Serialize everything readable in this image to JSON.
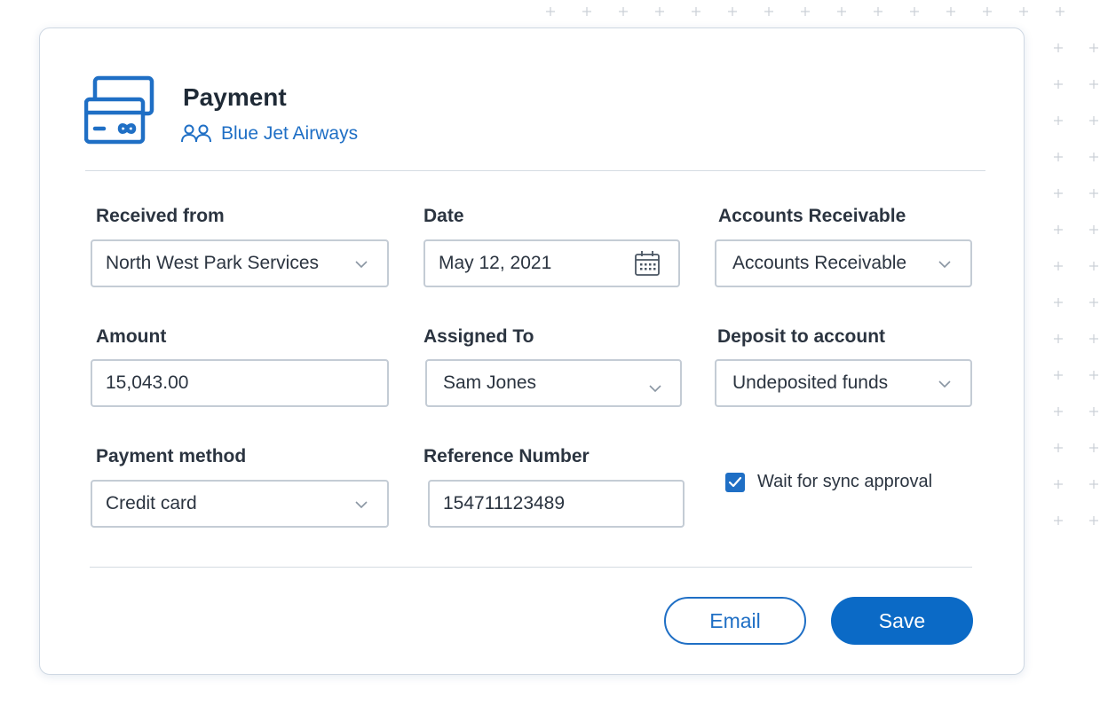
{
  "header": {
    "title": "Payment",
    "company": "Blue Jet Airways"
  },
  "fields": {
    "received_from": {
      "label": "Received from",
      "value": "North West Park Services"
    },
    "date": {
      "label": "Date",
      "value": "May 12, 2021"
    },
    "accounts_receivable": {
      "label": "Accounts Receivable",
      "value": "Accounts Receivable"
    },
    "amount": {
      "label": "Amount",
      "value": "15,043.00"
    },
    "assigned_to": {
      "label": "Assigned To",
      "value": "Sam Jones"
    },
    "deposit_to": {
      "label": "Deposit to account",
      "value": "Undeposited funds"
    },
    "payment_method": {
      "label": "Payment method",
      "value": "Credit card"
    },
    "reference_number": {
      "label": "Reference Number",
      "value": "154711123489"
    }
  },
  "sync": {
    "label": "Wait for sync approval",
    "checked": true
  },
  "actions": {
    "email_label": "Email",
    "save_label": "Save"
  },
  "colors": {
    "accent": "#1f6fc5",
    "primary_button": "#0b6ac6",
    "border": "#c4ccd5"
  }
}
